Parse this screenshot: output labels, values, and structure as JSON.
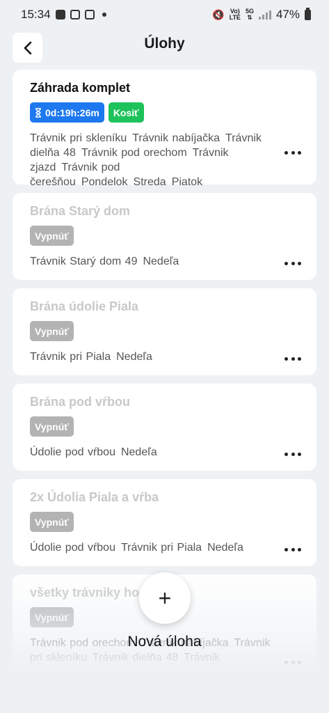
{
  "status": {
    "time": "15:34",
    "battery": "47%",
    "net1": "Vo) LTE",
    "net2": "5G"
  },
  "header": {
    "title": "Úlohy"
  },
  "tasks": [
    {
      "title": "Záhrada komplet",
      "timer": "0d:19h:26m",
      "status": "Kosiť",
      "details": [
        "Trávnik pri skleníku",
        "Trávnik nabíjačka",
        "Trávnik dielňa 48",
        "Trávnik pod orechom",
        "Trávnik zjazd",
        "Trávnik pod čerešňou",
        "Pondelok",
        "Streda",
        "Piatok"
      ]
    },
    {
      "title": "Brána Starý dom",
      "status": "Vypnúť",
      "details": [
        "Trávnik Starý dom 49",
        "Nedeľa"
      ]
    },
    {
      "title": "Brána údolie Piala",
      "status": "Vypnúť",
      "details": [
        "Trávnik pri Piala",
        "Nedeľa"
      ]
    },
    {
      "title": "Brána pod vŕbou",
      "status": "Vypnúť",
      "details": [
        "Údolie pod vŕbou",
        "Nedeľa"
      ]
    },
    {
      "title": "2x Údolia Piala a vŕba",
      "status": "Vypnúť",
      "details": [
        "Údolie pod vŕbou",
        "Trávnik pri Piala",
        "Nedeľa"
      ]
    },
    {
      "title": "všetky trávniky ho",
      "status": "Vypnúť",
      "details": [
        "Trávnik pod orechom",
        "Trávnik nabíjačka",
        "Trávnik pri skleníku",
        "Trávnik dielňa 48",
        "Trávnik"
      ]
    }
  ],
  "fab": {
    "icon": "+",
    "label": "Nová úloha"
  },
  "colors": {
    "background": "#eef1f4",
    "timer_badge": "#1e78f0",
    "mow_badge": "#1ec25a",
    "off_badge": "#b3b3b3"
  }
}
